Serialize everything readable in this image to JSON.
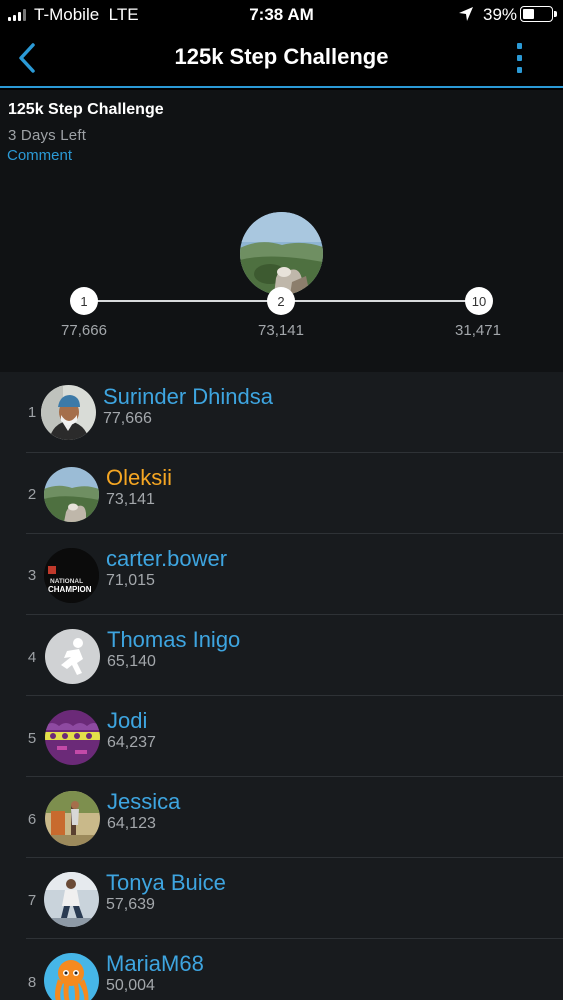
{
  "status_bar": {
    "carrier": "T-Mobile",
    "network": "LTE",
    "time": "7:38 AM",
    "battery": "39%",
    "battery_level": 0.39
  },
  "nav": {
    "title": "125k Step Challenge",
    "back_icon": "chevron-left-icon",
    "menu_icon": "more-vertical-icon",
    "accent": "#2b9ad6"
  },
  "challenge": {
    "title": "125k Step Challenge",
    "days_left": "3 Days Left",
    "comment_label": "Comment"
  },
  "ladder": [
    {
      "rank": "1",
      "steps": "77,666"
    },
    {
      "rank": "2",
      "steps": "73,141"
    },
    {
      "rank": "10",
      "steps": "31,471"
    }
  ],
  "leaderboard": [
    {
      "rank": "1",
      "name": "Surinder Dhindsa",
      "steps": "77,666"
    },
    {
      "rank": "2",
      "name": "Oleksii",
      "steps": "73,141",
      "is_me": true
    },
    {
      "rank": "3",
      "name": "carter.bower",
      "steps": "71,015",
      "avatar_text": "NATIONAL CHAMPION"
    },
    {
      "rank": "4",
      "name": "Thomas Inigo",
      "steps": "65,140"
    },
    {
      "rank": "5",
      "name": "Jodi",
      "steps": "64,237"
    },
    {
      "rank": "6",
      "name": "Jessica",
      "steps": "64,123"
    },
    {
      "rank": "7",
      "name": "Tonya Buice",
      "steps": "57,639"
    },
    {
      "rank": "8",
      "name": "MariaM68",
      "steps": "50,004"
    }
  ],
  "colors": {
    "accent_blue": "#3ea5e0",
    "current_user": "#f5a623"
  }
}
